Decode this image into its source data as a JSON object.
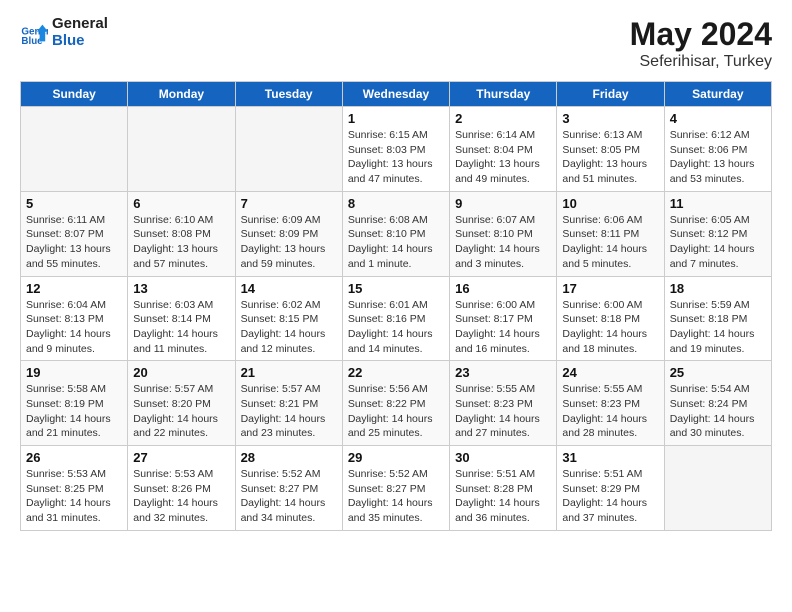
{
  "header": {
    "logo_general": "General",
    "logo_blue": "Blue",
    "main_title": "May 2024",
    "subtitle": "Seferihisar, Turkey"
  },
  "weekdays": [
    "Sunday",
    "Monday",
    "Tuesday",
    "Wednesday",
    "Thursday",
    "Friday",
    "Saturday"
  ],
  "weeks": [
    [
      {
        "day": "",
        "info": ""
      },
      {
        "day": "",
        "info": ""
      },
      {
        "day": "",
        "info": ""
      },
      {
        "day": "1",
        "info": "Sunrise: 6:15 AM\nSunset: 8:03 PM\nDaylight: 13 hours and 47 minutes."
      },
      {
        "day": "2",
        "info": "Sunrise: 6:14 AM\nSunset: 8:04 PM\nDaylight: 13 hours and 49 minutes."
      },
      {
        "day": "3",
        "info": "Sunrise: 6:13 AM\nSunset: 8:05 PM\nDaylight: 13 hours and 51 minutes."
      },
      {
        "day": "4",
        "info": "Sunrise: 6:12 AM\nSunset: 8:06 PM\nDaylight: 13 hours and 53 minutes."
      }
    ],
    [
      {
        "day": "5",
        "info": "Sunrise: 6:11 AM\nSunset: 8:07 PM\nDaylight: 13 hours and 55 minutes."
      },
      {
        "day": "6",
        "info": "Sunrise: 6:10 AM\nSunset: 8:08 PM\nDaylight: 13 hours and 57 minutes."
      },
      {
        "day": "7",
        "info": "Sunrise: 6:09 AM\nSunset: 8:09 PM\nDaylight: 13 hours and 59 minutes."
      },
      {
        "day": "8",
        "info": "Sunrise: 6:08 AM\nSunset: 8:10 PM\nDaylight: 14 hours and 1 minute."
      },
      {
        "day": "9",
        "info": "Sunrise: 6:07 AM\nSunset: 8:10 PM\nDaylight: 14 hours and 3 minutes."
      },
      {
        "day": "10",
        "info": "Sunrise: 6:06 AM\nSunset: 8:11 PM\nDaylight: 14 hours and 5 minutes."
      },
      {
        "day": "11",
        "info": "Sunrise: 6:05 AM\nSunset: 8:12 PM\nDaylight: 14 hours and 7 minutes."
      }
    ],
    [
      {
        "day": "12",
        "info": "Sunrise: 6:04 AM\nSunset: 8:13 PM\nDaylight: 14 hours and 9 minutes."
      },
      {
        "day": "13",
        "info": "Sunrise: 6:03 AM\nSunset: 8:14 PM\nDaylight: 14 hours and 11 minutes."
      },
      {
        "day": "14",
        "info": "Sunrise: 6:02 AM\nSunset: 8:15 PM\nDaylight: 14 hours and 12 minutes."
      },
      {
        "day": "15",
        "info": "Sunrise: 6:01 AM\nSunset: 8:16 PM\nDaylight: 14 hours and 14 minutes."
      },
      {
        "day": "16",
        "info": "Sunrise: 6:00 AM\nSunset: 8:17 PM\nDaylight: 14 hours and 16 minutes."
      },
      {
        "day": "17",
        "info": "Sunrise: 6:00 AM\nSunset: 8:18 PM\nDaylight: 14 hours and 18 minutes."
      },
      {
        "day": "18",
        "info": "Sunrise: 5:59 AM\nSunset: 8:18 PM\nDaylight: 14 hours and 19 minutes."
      }
    ],
    [
      {
        "day": "19",
        "info": "Sunrise: 5:58 AM\nSunset: 8:19 PM\nDaylight: 14 hours and 21 minutes."
      },
      {
        "day": "20",
        "info": "Sunrise: 5:57 AM\nSunset: 8:20 PM\nDaylight: 14 hours and 22 minutes."
      },
      {
        "day": "21",
        "info": "Sunrise: 5:57 AM\nSunset: 8:21 PM\nDaylight: 14 hours and 23 minutes."
      },
      {
        "day": "22",
        "info": "Sunrise: 5:56 AM\nSunset: 8:22 PM\nDaylight: 14 hours and 25 minutes."
      },
      {
        "day": "23",
        "info": "Sunrise: 5:55 AM\nSunset: 8:23 PM\nDaylight: 14 hours and 27 minutes."
      },
      {
        "day": "24",
        "info": "Sunrise: 5:55 AM\nSunset: 8:23 PM\nDaylight: 14 hours and 28 minutes."
      },
      {
        "day": "25",
        "info": "Sunrise: 5:54 AM\nSunset: 8:24 PM\nDaylight: 14 hours and 30 minutes."
      }
    ],
    [
      {
        "day": "26",
        "info": "Sunrise: 5:53 AM\nSunset: 8:25 PM\nDaylight: 14 hours and 31 minutes."
      },
      {
        "day": "27",
        "info": "Sunrise: 5:53 AM\nSunset: 8:26 PM\nDaylight: 14 hours and 32 minutes."
      },
      {
        "day": "28",
        "info": "Sunrise: 5:52 AM\nSunset: 8:27 PM\nDaylight: 14 hours and 34 minutes."
      },
      {
        "day": "29",
        "info": "Sunrise: 5:52 AM\nSunset: 8:27 PM\nDaylight: 14 hours and 35 minutes."
      },
      {
        "day": "30",
        "info": "Sunrise: 5:51 AM\nSunset: 8:28 PM\nDaylight: 14 hours and 36 minutes."
      },
      {
        "day": "31",
        "info": "Sunrise: 5:51 AM\nSunset: 8:29 PM\nDaylight: 14 hours and 37 minutes."
      },
      {
        "day": "",
        "info": ""
      }
    ]
  ]
}
